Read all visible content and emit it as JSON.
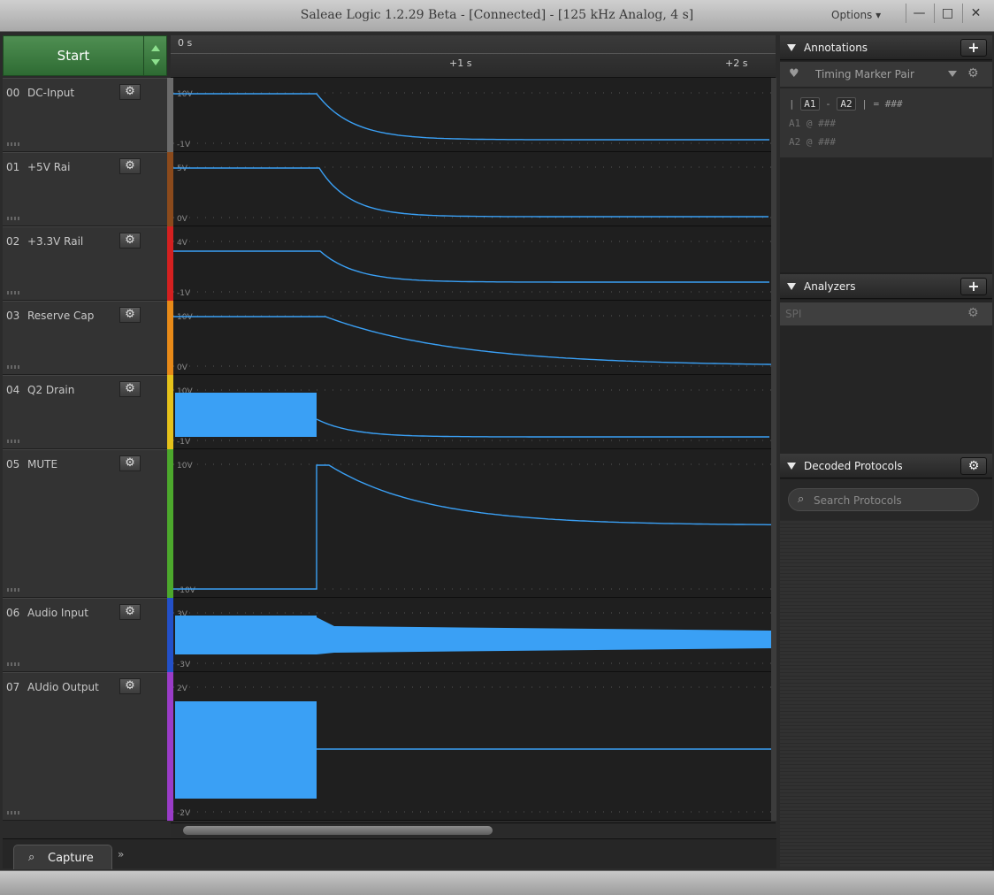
{
  "window": {
    "title": "Saleae Logic 1.2.29 Beta - [Connected] - [125 kHz Analog, 4 s]",
    "options_label": "Options ▾",
    "minimize_glyph": "—",
    "maximize_glyph": "□",
    "close_glyph": "✕"
  },
  "start_button": {
    "label": "Start"
  },
  "ruler": {
    "ticks": [
      {
        "label": "0 s"
      },
      {
        "label": "+1 s"
      },
      {
        "label": "+2 s"
      }
    ]
  },
  "channels": [
    {
      "num": "00",
      "name": "DC-Input",
      "color": "#6b6b6b",
      "ymax": "10V",
      "ymin": "-1V"
    },
    {
      "num": "01",
      "name": "+5V Rai",
      "color": "#8b4a1c",
      "ymax": "5V",
      "ymin": "0V"
    },
    {
      "num": "02",
      "name": "+3.3V Rail",
      "color": "#d42020",
      "ymax": "4V",
      "ymin": "-1V"
    },
    {
      "num": "03",
      "name": "Reserve Cap",
      "color": "#e88a18",
      "ymax": "10V",
      "ymin": "0V"
    },
    {
      "num": "04",
      "name": "Q2 Drain",
      "color": "#e6c21a",
      "ymax": "10V",
      "ymin": "-1V"
    },
    {
      "num": "05",
      "name": "MUTE",
      "color": "#4ca82c",
      "ymax": "10V",
      "ymin": "-10V"
    },
    {
      "num": "06",
      "name": "Audio Input",
      "color": "#2350c8",
      "ymax": "3V",
      "ymin": "-3V"
    },
    {
      "num": "07",
      "name": "AUdio Output",
      "color": "#9a3cc8",
      "ymax": "2V",
      "ymin": "-2V"
    }
  ],
  "icons": {
    "gear": "⚙",
    "search": "⌕",
    "capture": "⌕",
    "chevrons": "»",
    "marker": "♥"
  },
  "trace_color": "#3aa0f5",
  "bottom": {
    "capture_tab": "Capture"
  },
  "annotations": {
    "header": "Annotations",
    "add_label": "+",
    "marker_pair": "Timing Marker Pair",
    "line1": {
      "prefix": "|",
      "a1": "A1",
      "dash": "-",
      "a2": "A2",
      "suffix": "| = ###"
    },
    "line2": "A1  @  ###",
    "line3": "A2  @  ###"
  },
  "analyzers": {
    "header": "Analyzers",
    "add_label": "+",
    "items": [
      {
        "name": "SPI"
      }
    ]
  },
  "decoded": {
    "header": "Decoded Protocols",
    "search_placeholder": "Search Protocols"
  }
}
